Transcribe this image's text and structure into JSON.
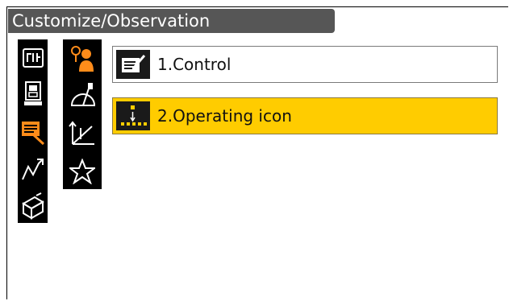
{
  "window": {
    "title": "Customize/Observation"
  },
  "sidebar_left": {
    "items": [
      {
        "icon": "keyboard-icon"
      },
      {
        "icon": "instrument-icon"
      },
      {
        "icon": "edit-list-icon",
        "active": true
      },
      {
        "icon": "graph-icon"
      },
      {
        "icon": "toolbox-icon"
      }
    ]
  },
  "sidebar_right": {
    "items": [
      {
        "icon": "surveyor-icon",
        "active": true
      },
      {
        "icon": "protractor-icon"
      },
      {
        "icon": "coordinate-axes-icon"
      },
      {
        "icon": "star-icon"
      }
    ]
  },
  "menu": {
    "items": [
      {
        "label": "1.Control",
        "icon": "control-icon",
        "selected": false
      },
      {
        "label": "2.Operating icon",
        "icon": "operating-icon",
        "selected": true
      }
    ]
  },
  "colors": {
    "accent": "#ff8c1a",
    "selection": "#ffcc00",
    "titlebar": "#565656",
    "sidebar": "#000000"
  }
}
